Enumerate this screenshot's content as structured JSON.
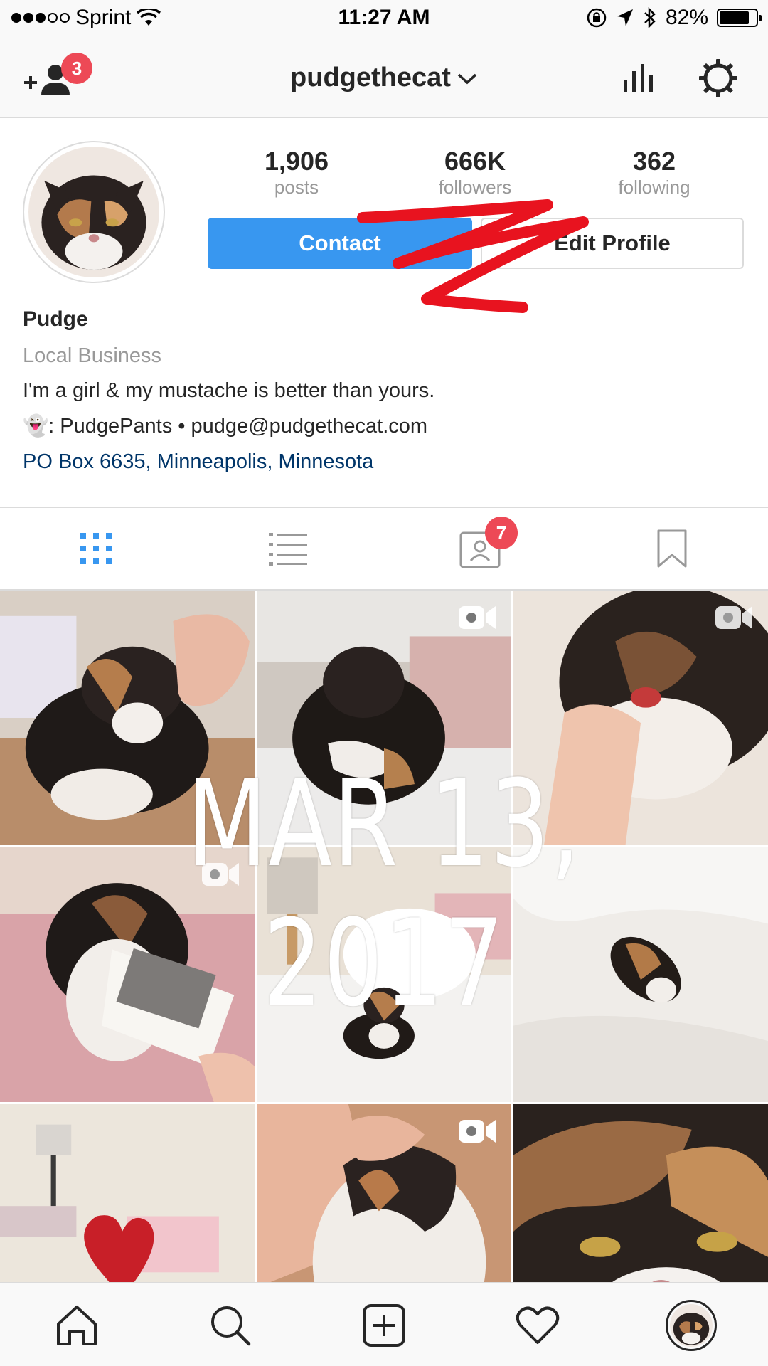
{
  "status_bar": {
    "carrier": "Sprint",
    "time": "11:27 AM",
    "battery": "82%",
    "battery_level": 0.82,
    "signal_bars_filled": 3,
    "signal_bars_total": 5
  },
  "nav": {
    "username": "pudgethecat",
    "add_friends_badge": "3",
    "icons": [
      "add-person-icon",
      "chevron-down-icon",
      "insights-icon",
      "gear-icon"
    ]
  },
  "profile": {
    "stats": [
      {
        "value": "1,906",
        "label": "posts"
      },
      {
        "value": "666K",
        "label": "followers"
      },
      {
        "value": "362",
        "label": "following"
      }
    ],
    "contact_button": "Contact",
    "edit_button": "Edit Profile",
    "name": "Pudge",
    "category": "Local Business",
    "bio": "I'm a girl & my mustache is better than yours.",
    "contact_line": "👻: PudgePants • pudge@pudgethecat.com",
    "address": "PO Box 6635, Minneapolis, Minnesota"
  },
  "tabs": {
    "items": [
      "grid-icon",
      "list-icon",
      "tagged-icon",
      "bookmark-icon"
    ],
    "tagged_badge": "7"
  },
  "overlay_date": "MAR 13, 2017",
  "bottom_nav": {
    "items": [
      "home-icon",
      "search-icon",
      "new-post-icon",
      "activity-heart-icon",
      "profile-avatar"
    ]
  },
  "colors": {
    "accent_blue": "#3897f0",
    "badge_red": "#ed4956",
    "link_navy": "#003569",
    "scribble_red": "#e8131f"
  }
}
